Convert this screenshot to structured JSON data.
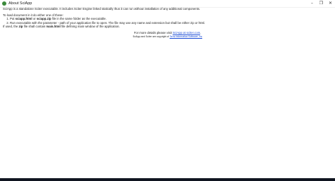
{
  "window": {
    "title": "About SciApp",
    "minimize_glyph": "–",
    "maximize_glyph": "❐",
    "close_glyph": "✕"
  },
  "content": {
    "intro": "SciApp is a standalone Sciter executable. It includes Sciter Engine linked statically thus it can run without installation of any additional components.",
    "load_intro": "To load document in it do either one of these:",
    "step1": {
      "prefix": "Put ",
      "file1": "sciapp.html",
      "middle": " or ",
      "file2": "sciapp.zip",
      "suffix": " file in the same folder as the executable."
    },
    "step2": "Run executable with the parameter - path of your application file to open. The file may use any name and extension but shall be either zip or html.",
    "zip_note": {
      "prefix": "If used, the ",
      "zip": "zip",
      "middle": " file shall contain ",
      "main": "main.html",
      "suffix": " file defining main window of the application."
    },
    "details": {
      "prefix": "For more details please visit ",
      "link": "SciApp at sciter.com",
      "suffix": "."
    },
    "copyright": {
      "prefix": "SciApp and Sciter are copyright of ",
      "link": "Terra Informatica Software, Inc"
    }
  },
  "colors": {
    "link": "#1a4bd6",
    "taskbar": "#101520",
    "app_icon": "#3c8a3c"
  }
}
